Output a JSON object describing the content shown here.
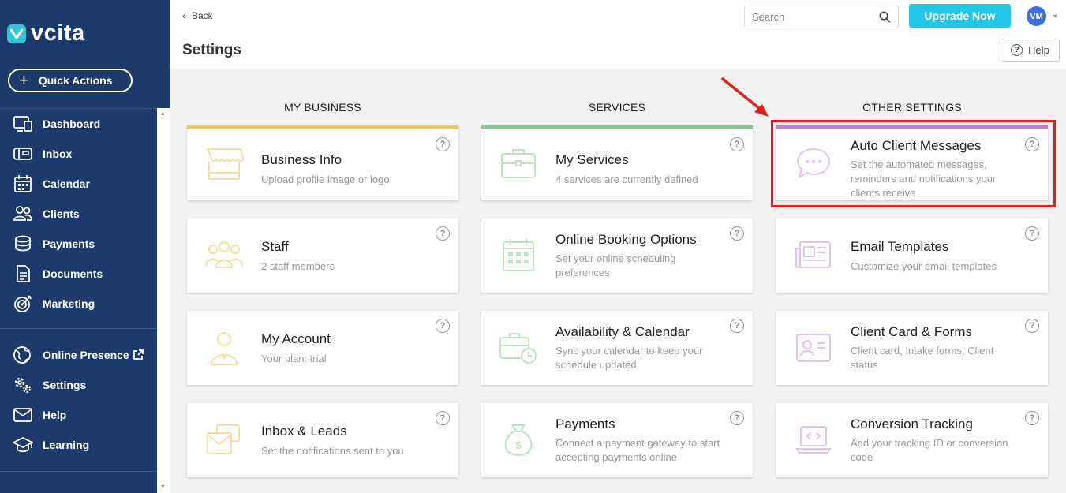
{
  "brand": {
    "name": "vcita",
    "accent": "#33c3d9"
  },
  "sidebar": {
    "quick_actions": "Quick Actions",
    "items": [
      {
        "label": "Dashboard",
        "icon": "dashboard-icon"
      },
      {
        "label": "Inbox",
        "icon": "inbox-icon"
      },
      {
        "label": "Calendar",
        "icon": "calendar-icon"
      },
      {
        "label": "Clients",
        "icon": "clients-icon"
      },
      {
        "label": "Payments",
        "icon": "payments-icon"
      },
      {
        "label": "Documents",
        "icon": "documents-icon"
      },
      {
        "label": "Marketing",
        "icon": "marketing-icon"
      },
      {
        "label": "Online Presence",
        "icon": "globe-icon"
      },
      {
        "label": "Settings",
        "icon": "settings-icon"
      },
      {
        "label": "Help",
        "icon": "help-icon"
      },
      {
        "label": "Learning",
        "icon": "learning-icon"
      }
    ]
  },
  "topbar": {
    "back": "Back",
    "search_placeholder": "Search",
    "upgrade": "Upgrade Now",
    "avatar": "VM"
  },
  "header": {
    "title": "Settings",
    "help": "Help"
  },
  "columns": [
    {
      "title": "MY BUSINESS",
      "accent": "#f0c94a",
      "cards": [
        {
          "title": "Business Info",
          "desc": "Upload profile image or logo"
        },
        {
          "title": "Staff",
          "desc": "2 staff members"
        },
        {
          "title": "My Account",
          "desc": "Your plan: trial"
        },
        {
          "title": "Inbox & Leads",
          "desc": "Set the notifications sent to you"
        }
      ]
    },
    {
      "title": "SERVICES",
      "accent": "#7ec98a",
      "cards": [
        {
          "title": "My Services",
          "desc": "4 services are currently defined"
        },
        {
          "title": "Online Booking Options",
          "desc": "Set your online scheduling preferences"
        },
        {
          "title": "Availability & Calendar",
          "desc": "Sync your calendar to keep your schedule updated"
        },
        {
          "title": "Payments",
          "desc": "Connect a payment gateway to start accepting payments online"
        }
      ]
    },
    {
      "title": "OTHER SETTINGS",
      "accent": "#c37dd3",
      "cards": [
        {
          "title": "Auto Client Messages",
          "desc": "Set the automated messages, reminders and notifications your clients receive"
        },
        {
          "title": "Email Templates",
          "desc": "Customize your email templates"
        },
        {
          "title": "Client Card & Forms",
          "desc": "Client card, Intake forms, Client status"
        },
        {
          "title": "Conversion Tracking",
          "desc": "Add your tracking ID or conversion code"
        }
      ]
    }
  ]
}
